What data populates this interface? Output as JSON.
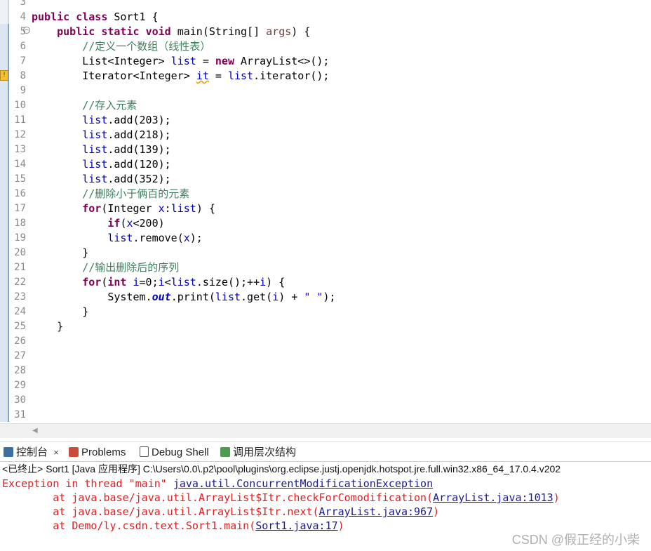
{
  "editor": {
    "lines": [
      {
        "n": "3",
        "code": ""
      },
      {
        "n": "4",
        "code": "<span class='kw'>public</span> <span class='kw'>class</span> Sort1 {"
      },
      {
        "n": "5",
        "code": "    <span class='kw'>public</span> <span class='kw'>static</span> <span class='kw'>void</span> main(String[] <span class='var'>args</span>) {",
        "fold": true
      },
      {
        "n": "6",
        "code": "        <span class='cm'>//定义一个数组（线性表）</span>"
      },
      {
        "n": "7",
        "code": "        List&lt;Integer&gt; <span class='fld'>list</span> = <span class='kw'>new</span> ArrayList&lt;&gt;();"
      },
      {
        "n": "8",
        "code": "        Iterator&lt;Integer&gt; <span class='fld squig'>it</span> = <span class='fld'>list</span>.iterator();",
        "warn": true
      },
      {
        "n": "9",
        "code": ""
      },
      {
        "n": "10",
        "code": "        <span class='cm'>//存入元素</span>"
      },
      {
        "n": "11",
        "code": "        <span class='fld'>list</span>.add(203);"
      },
      {
        "n": "12",
        "code": "        <span class='fld'>list</span>.add(218);"
      },
      {
        "n": "13",
        "code": "        <span class='fld'>list</span>.add(139);"
      },
      {
        "n": "14",
        "code": "        <span class='fld'>list</span>.add(120);"
      },
      {
        "n": "15",
        "code": "        <span class='fld'>list</span>.add(352);"
      },
      {
        "n": "16",
        "code": "        <span class='cm'>//删除小于俩百的元素</span>"
      },
      {
        "n": "17",
        "code": "        <span class='kw'>for</span>(Integer <span class='fld'>x</span>:<span class='fld'>list</span>) {"
      },
      {
        "n": "18",
        "code": "            <span class='kw'>if</span>(<span class='fld'>x</span>&lt;200)"
      },
      {
        "n": "19",
        "code": "            <span class='fld'>list</span>.remove(<span class='fld'>x</span>);"
      },
      {
        "n": "20",
        "code": "        }"
      },
      {
        "n": "21",
        "code": "        <span class='cm'>//输出删除后的序列</span>"
      },
      {
        "n": "22",
        "code": "        <span class='kw'>for</span>(<span class='kw'>int</span> <span class='fld'>i</span>=0;<span class='fld'>i</span>&lt;<span class='fld'>list</span>.size();++<span class='fld'>i</span>) {"
      },
      {
        "n": "23",
        "code": "            System.<span class='it'>out</span>.print(<span class='fld'>list</span>.get(<span class='fld'>i</span>) + <span class='str'>\" \"</span>);"
      },
      {
        "n": "24",
        "code": "        }"
      },
      {
        "n": "25",
        "code": "    }"
      },
      {
        "n": "26",
        "code": ""
      },
      {
        "n": "27",
        "code": ""
      },
      {
        "n": "28",
        "code": ""
      },
      {
        "n": "29",
        "code": ""
      },
      {
        "n": "30",
        "code": ""
      },
      {
        "n": "31",
        "code": ""
      }
    ]
  },
  "tabs": {
    "console": "控制台",
    "console_close": "×",
    "problems": "Problems",
    "debug_shell": "Debug Shell",
    "call_hierarchy": "调用层次结构"
  },
  "status": {
    "text": "<已终止> Sort1 [Java 应用程序] C:\\Users\\0.0\\.p2\\pool\\plugins\\org.eclipse.justj.openjdk.hotspot.jre.full.win32.x86_64_17.0.4.v202"
  },
  "console": {
    "line1_prefix": "Exception in thread \"main\" ",
    "line1_link": "java.util.ConcurrentModificationException",
    "line2_prefix": "        at java.base/java.util.ArrayList$Itr.checkForComodification(",
    "line2_link": "ArrayList.java:1013",
    "line3_prefix": "        at java.base/java.util.ArrayList$Itr.next(",
    "line3_link": "ArrayList.java:967",
    "line4_prefix": "        at Demo/ly.csdn.text.Sort1.main(",
    "line4_link": "Sort1.java:17",
    "close_paren": ")"
  },
  "watermark": "CSDN @假正经的小柴",
  "colors": {
    "keyword": "#7f0055",
    "comment": "#3f7f5f",
    "field": "#0000c0",
    "error": "#e02020",
    "link": "#1a1a8c"
  }
}
